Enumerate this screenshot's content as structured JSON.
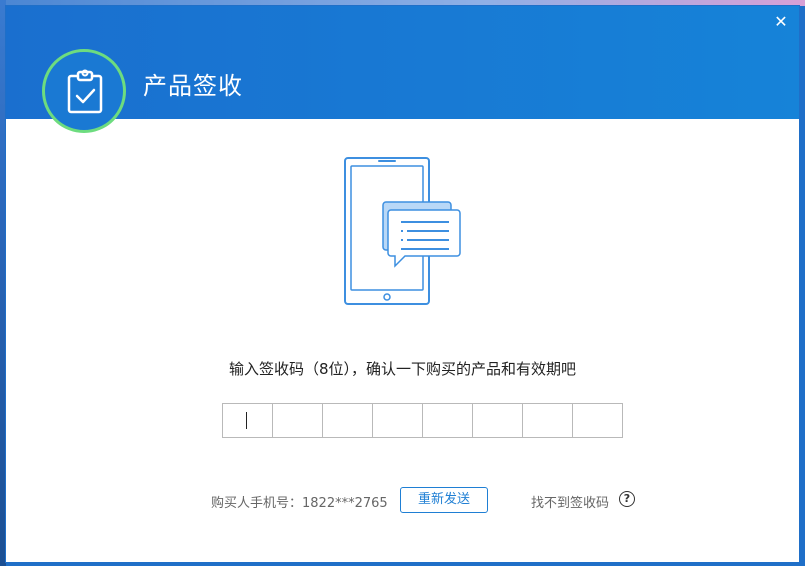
{
  "window": {
    "title": "产品签收",
    "close_glyph": "✕"
  },
  "colors": {
    "header_blue": "#1a6fcf",
    "accent_blue": "#1f7fd4",
    "logo_ring_green": "#6ddc7f"
  },
  "icons": {
    "logo": "clipboard-check-icon",
    "illustration": "phone-message-illustration",
    "help": "question-circle-icon",
    "close": "close-icon"
  },
  "main": {
    "instruction": "输入签收码（8位），确认一下购买的产品和有效期吧",
    "code_digits": [
      "",
      "",
      "",
      "",
      "",
      "",
      "",
      ""
    ]
  },
  "footer": {
    "phone_label": "购买人手机号：",
    "phone_number": "1822***2765",
    "resend_label": "重新发送",
    "no_code_label": "找不到签收码",
    "help_glyph": "?"
  }
}
